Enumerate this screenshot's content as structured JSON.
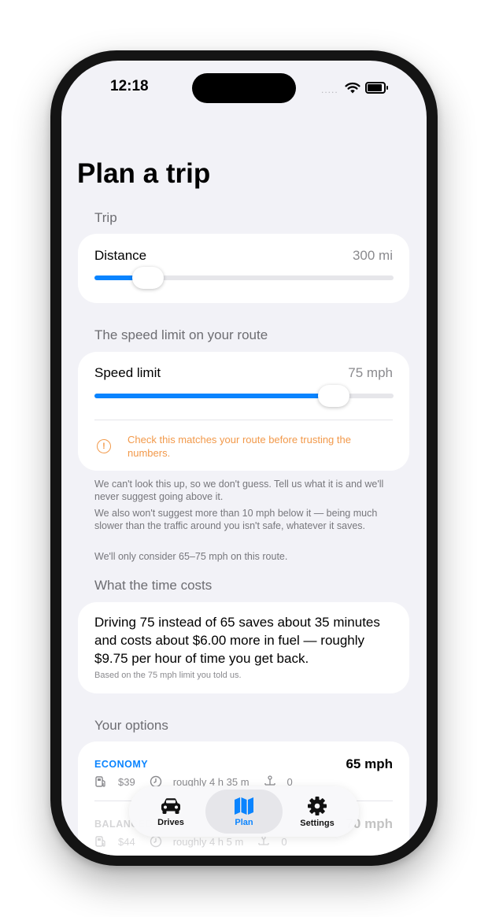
{
  "status_bar": {
    "time": "12:18",
    "signal_dots": "....."
  },
  "page_title": "Plan a trip",
  "trip_section": {
    "label": "Trip",
    "distance": {
      "label": "Distance",
      "value": "300 mi",
      "slider_fraction": 0.18
    }
  },
  "speed_section": {
    "label": "The speed limit on your route",
    "speed_limit": {
      "label": "Speed limit",
      "value": "75 mph",
      "slider_fraction": 0.8
    },
    "warning_icon_glyph": "!",
    "warning": "Check this matches your route before trusting the numbers.",
    "notes": [
      "We can't look this up, so we don't guess. Tell us what it is and we'll never suggest going above it.",
      "We also won't suggest more than 10 mph below it — being much slower than the traffic around you isn't safe, whatever it saves.",
      "We'll only consider 65–75 mph on this route."
    ]
  },
  "time_cost_section": {
    "label": "What the time costs",
    "summary": "Driving 75 instead of 65 saves about 35 minutes and costs about $6.00 more in fuel — roughly $9.75 per hour of time you get back.",
    "note": "Based on the 75 mph limit you told us."
  },
  "options_section": {
    "label": "Your options",
    "options": [
      {
        "name": "ECONOMY",
        "speed": "65 mph",
        "fuel": "$39",
        "time": "roughly 4 h 35 m",
        "count": "0"
      },
      {
        "name": "BALANCED",
        "speed": "70 mph",
        "fuel": "$44",
        "time": "roughly 4 h 5 m",
        "count": "0"
      }
    ]
  },
  "tabs": [
    {
      "label": "Drives",
      "icon": "car-icon",
      "active": false
    },
    {
      "label": "Plan",
      "icon": "map-icon",
      "active": true
    },
    {
      "label": "Settings",
      "icon": "gear-icon",
      "active": false
    }
  ],
  "colors": {
    "accent": "#0a84ff",
    "warning": "#f2994a",
    "background": "#f2f2f7"
  }
}
